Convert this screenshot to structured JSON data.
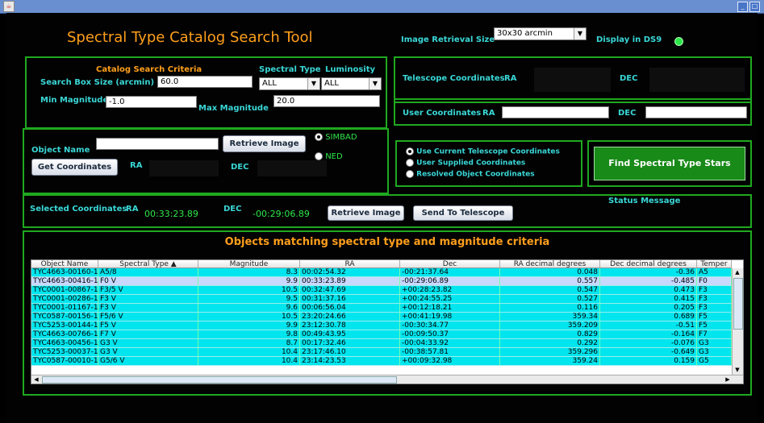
{
  "window": {
    "icon_glyph": "☕",
    "minimize_glyph": "_",
    "maximize_glyph": "□"
  },
  "app_title": "Spectral Type Catalog Search Tool",
  "header": {
    "image_retrieval_label": "Image Retrieval Size",
    "image_retrieval_value": "30x30 arcmin",
    "display_ds9_label": "Display in DS9"
  },
  "criteria": {
    "heading": "Catalog Search Criteria",
    "spectral_type_label": "Spectral Type",
    "luminosity_label": "Luminosity",
    "search_box_label": "Search Box Size (arcmin)",
    "search_box_value": "60.0",
    "spectral_type_value": "ALL",
    "luminosity_value": "ALL",
    "min_mag_label": "Min Magnitude",
    "min_mag_value": "-1.0",
    "max_mag_label": "Max Magnitude",
    "max_mag_value": "20.0"
  },
  "telescope": {
    "label": "Telescope Coordinates",
    "ra_label": "RA",
    "dec_label": "DEC"
  },
  "user_coords": {
    "label": "User Coordinates",
    "ra_label": "RA",
    "dec_label": "DEC"
  },
  "object": {
    "name_label": "Object Name",
    "retrieve_button": "Retrieve Image",
    "simbad_label": "SIMBAD",
    "ned_label": "NED",
    "get_coords_button": "Get Coordinates",
    "ra_label": "RA",
    "dec_label": "DEC"
  },
  "coord_source": {
    "options": [
      "Use Current Telescope Coordinates",
      "User Supplied Coordinates",
      "Resolved Object Coordinates"
    ]
  },
  "find_button": "Find Spectral Type Stars",
  "selected": {
    "label": "Selected Coordinates",
    "ra_label": "RA",
    "ra_value": "00:33:23.89",
    "dec_label": "DEC",
    "dec_value": "-00:29:06.89",
    "retrieve_button": "Retrieve Image",
    "send_button": "Send To Telescope"
  },
  "status_label": "Status Message",
  "results": {
    "title": "Objects matching spectral type and magnitude criteria",
    "columns": [
      "Object Name",
      "Spectral Type ▲",
      "Magnitude",
      "RA",
      "Dec",
      "RA decimal degrees",
      "Dec decimal degrees",
      "Temper"
    ],
    "rows": [
      [
        "TYC4663-00160-1",
        "A5/8",
        "8.3",
        "00:02:54.32",
        "-00:21:37.64",
        "0.048",
        "-0.36",
        "A5"
      ],
      [
        "TYC4663-00416-1",
        "F0 V",
        "9.9",
        "00:33:23.89",
        "-00:29:06.89",
        "0.557",
        "-0.485",
        "F0"
      ],
      [
        "TYC0001-00867-1",
        "F3/5 V",
        "10.5",
        "00:32:47.69",
        "+00:28:23.82",
        "0.547",
        "0.473",
        "F3"
      ],
      [
        "TYC0001-00286-1",
        "F3 V",
        "9.5",
        "00:31:37.16",
        "+00:24:55.25",
        "0.527",
        "0.415",
        "F3"
      ],
      [
        "TYC0001-01167-1",
        "F3 V",
        "9.6",
        "00:06:56.04",
        "+00:12:18.21",
        "0.116",
        "0.205",
        "F3"
      ],
      [
        "TYC0587-00156-1",
        "F5/6 V",
        "10.5",
        "23:20:24.66",
        "+00:41:19.98",
        "359.34",
        "0.689",
        "F5"
      ],
      [
        "TYC5253-00144-1",
        "F5 V",
        "9.9",
        "23:12:30.78",
        "-00:30:34.77",
        "359.209",
        "-0.51",
        "F5"
      ],
      [
        "TYC4663-00766-1",
        "F7 V",
        "9.8",
        "00:49:43.95",
        "-00:09:50.37",
        "0.829",
        "-0.164",
        "F7"
      ],
      [
        "TYC4663-00456-1",
        "G3 V",
        "8.7",
        "00:17:32.46",
        "-00:04:33.92",
        "0.292",
        "-0.076",
        "G3"
      ],
      [
        "TYC5253-00037-1",
        "G3 V",
        "10.4",
        "23:17:46.10",
        "-00:38:57.81",
        "359.296",
        "-0.649",
        "G3"
      ],
      [
        "TYC0587-00010-1",
        "G5/6 V",
        "10.4",
        "23:14:23.53",
        "+00:09:32.98",
        "359.24",
        "0.159",
        "G5"
      ]
    ],
    "selected_row": 1,
    "scroll_up_glyph": "▲",
    "scroll_down_glyph": "▼",
    "scroll_left_glyph": "◀",
    "scroll_right_glyph": "▶"
  },
  "colors": {
    "panel_border": "#1fa81f",
    "label": "#3ad7d7",
    "title": "#ff9f1c",
    "row_bg": "#00e5ee",
    "row_selected": "#c8d8ff",
    "find_button": "#188a18"
  }
}
